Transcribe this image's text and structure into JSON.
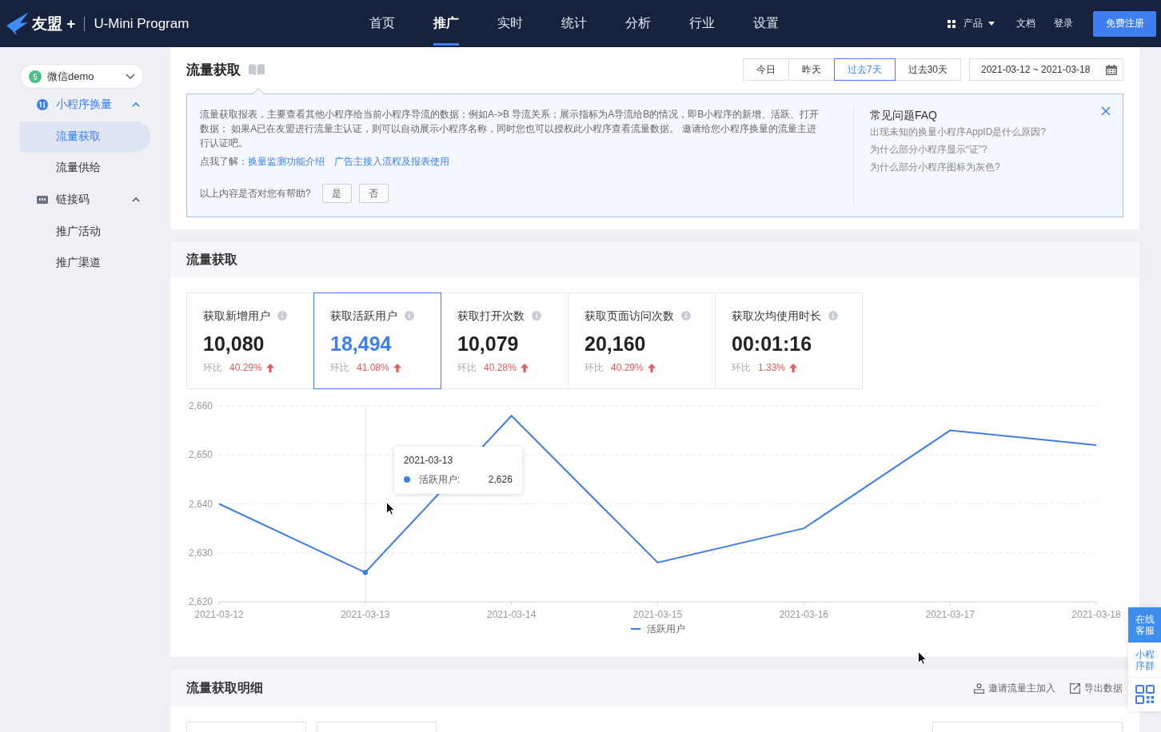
{
  "nav": {
    "brand": "友盟 +",
    "product": "U-Mini Program",
    "items": [
      {
        "label": "首页",
        "selected": false
      },
      {
        "label": "推广",
        "selected": true
      },
      {
        "label": "实时",
        "selected": false
      },
      {
        "label": "统计",
        "selected": false
      },
      {
        "label": "分析",
        "selected": false
      },
      {
        "label": "行业",
        "selected": false
      },
      {
        "label": "设置",
        "selected": false
      }
    ],
    "products": "产品",
    "docs": "文档",
    "login": "登录",
    "signup": "免费注册"
  },
  "sidebar": {
    "app_selector": "微信demo",
    "groups": [
      {
        "label": "小程序换量",
        "selected": true,
        "expanded": true,
        "children": [
          {
            "label": "流量获取",
            "selected": true
          },
          {
            "label": "流量供给",
            "selected": false
          }
        ]
      },
      {
        "label": "链接码",
        "selected": false,
        "expanded": true,
        "children": [
          {
            "label": "推广活动",
            "selected": false
          },
          {
            "label": "推广渠道",
            "selected": false
          }
        ]
      }
    ]
  },
  "report_header": {
    "title": "流量获取",
    "ranges": [
      {
        "label": "今日",
        "selected": false
      },
      {
        "label": "昨天",
        "selected": false
      },
      {
        "label": "过去7天",
        "selected": true
      },
      {
        "label": "过去30天",
        "selected": false
      }
    ],
    "date_range": "2021-03-12 ~ 2021-03-18"
  },
  "info": {
    "description": "流量获取报表，主要查看其他小程序给当前小程序导流的数据；例如A->B 导流关系；展示指标为A导流给B的情况，即B小程序的新增、活跃、打开数据； 如果A已在友盟进行流量主认证，则可以自动展示小程序名称，同时您也可以授权此小程序查看流量数据。 邀请给您小程序换量的流量主进行认证吧。",
    "learn_label": "点我了解：",
    "links": [
      "换量监测功能介绍",
      "广告主接入流程及报表使用"
    ],
    "feedback_question": "以上内容是否对您有帮助?",
    "feedback_buttons": [
      "是",
      "否"
    ],
    "faq_title": "常见问题FAQ",
    "faq_items": [
      "出现未知的换量小程序AppID是什么原因?",
      "为什么部分小程序显示“证”?",
      "为什么部分小程序图标为灰色?"
    ]
  },
  "overview": {
    "title": "流量获取",
    "metrics": [
      {
        "label": "获取新增用户",
        "value": "10,080",
        "compare_label": "环比",
        "change": "40.29%",
        "rising": true,
        "selected": false
      },
      {
        "label": "获取活跃用户",
        "value": "18,494",
        "compare_label": "环比",
        "change": "41.08%",
        "rising": true,
        "selected": true
      },
      {
        "label": "获取打开次数",
        "value": "10,079",
        "compare_label": "环比",
        "change": "40.28%",
        "rising": true,
        "selected": false
      },
      {
        "label": "获取页面访问次数",
        "value": "20,160",
        "compare_label": "环比",
        "change": "40.29%",
        "rising": true,
        "selected": false
      },
      {
        "label": "获取次均使用时长",
        "value": "00:01:16",
        "compare_label": "环比",
        "change": "1.33%",
        "rising": true,
        "selected": false
      }
    ],
    "chart_data": {
      "type": "line",
      "categories": [
        "2021-03-12",
        "2021-03-13",
        "2021-03-14",
        "2021-03-15",
        "2021-03-16",
        "2021-03-17",
        "2021-03-18"
      ],
      "series": [
        {
          "name": "活跃用户",
          "color": "#3f7ee8",
          "values": [
            2640,
            2626,
            2658,
            2628,
            2635,
            2655,
            2652
          ]
        }
      ],
      "ylim": [
        2620,
        2660
      ],
      "yticks": [
        {
          "value": 2620,
          "label": "2,620"
        },
        {
          "value": 2630,
          "label": "2,630"
        },
        {
          "value": 2640,
          "label": "2,640"
        },
        {
          "value": 2650,
          "label": "2,650"
        },
        {
          "value": 2660,
          "label": "2,660"
        }
      ],
      "grid": true
    },
    "points": [
      {
        "hovered": false
      },
      {
        "hovered": true
      },
      {
        "hovered": false
      },
      {
        "hovered": false
      },
      {
        "hovered": false
      },
      {
        "hovered": false
      },
      {
        "hovered": false
      }
    ],
    "tooltip": {
      "date": "2021-03-13",
      "label": "活跃用户:",
      "value": "2,626"
    }
  },
  "detail": {
    "title": "流量获取明细",
    "actions": [
      "邀请流量主加入",
      "导出数据"
    ]
  },
  "float_widget": {
    "items": [
      {
        "kind": "primary",
        "label": "在线客服"
      },
      {
        "kind": "plain",
        "label": "小程序群"
      },
      {
        "kind": "qr"
      }
    ]
  }
}
